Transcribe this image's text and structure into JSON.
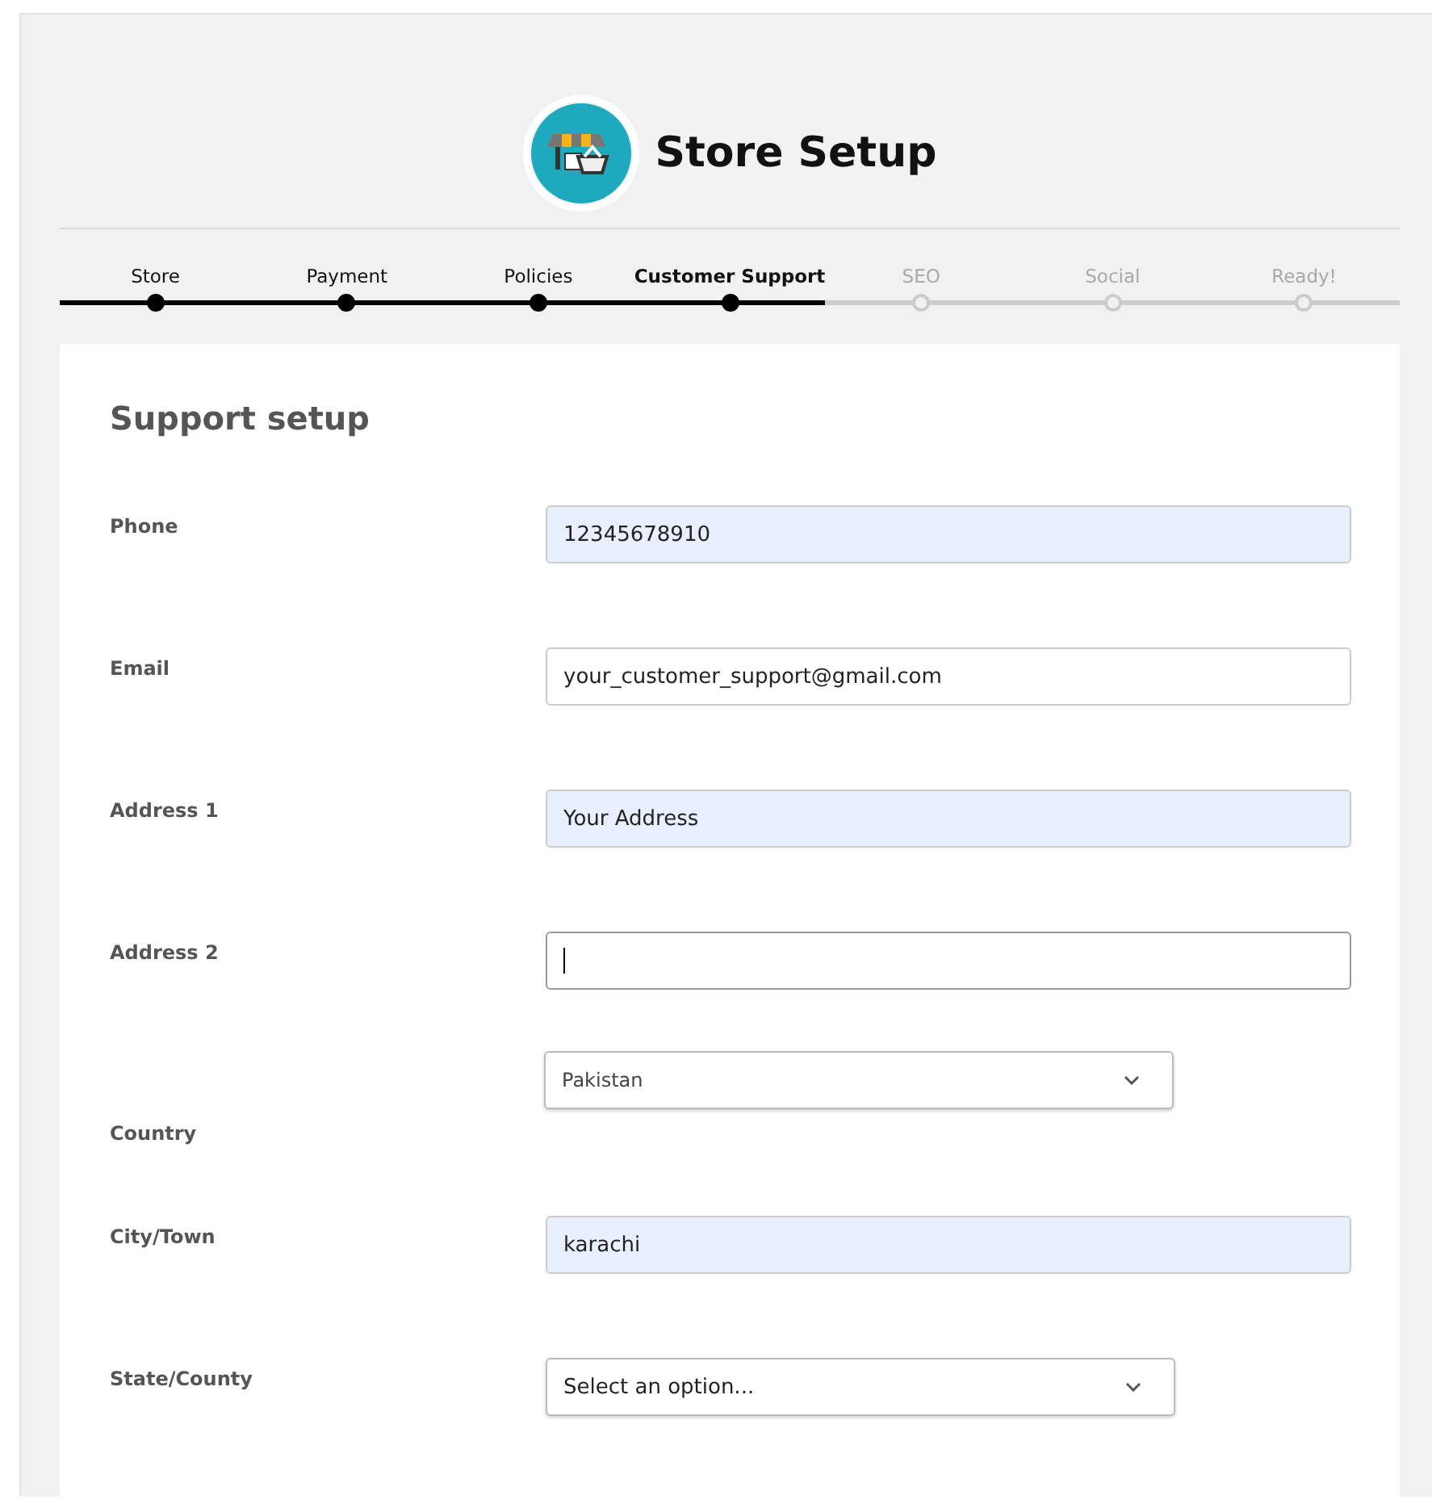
{
  "header": {
    "title": "Store Setup"
  },
  "steps": [
    {
      "label": "Store",
      "completed": true,
      "selected": false
    },
    {
      "label": "Payment",
      "completed": true,
      "selected": false
    },
    {
      "label": "Policies",
      "completed": true,
      "selected": false
    },
    {
      "label": "Customer Support",
      "completed": true,
      "selected": true
    },
    {
      "label": "SEO",
      "completed": false,
      "selected": false
    },
    {
      "label": "Social",
      "completed": false,
      "selected": false
    },
    {
      "label": "Ready!",
      "completed": false,
      "selected": false
    }
  ],
  "form": {
    "title": "Support setup",
    "fields": [
      {
        "label": "Phone",
        "kind": "text",
        "value": "12345678910",
        "autofilled": true,
        "focused": false
      },
      {
        "label": "Email",
        "kind": "text",
        "value": "your_customer_support@gmail.com",
        "autofilled": false,
        "focused": false
      },
      {
        "label": "Address 1",
        "kind": "text",
        "value": "Your Address",
        "autofilled": true,
        "focused": false
      },
      {
        "label": "Address 2",
        "kind": "text",
        "autofilled": false,
        "focused": true
      },
      {
        "label": "Country",
        "kind": "select",
        "value": "Pakistan",
        "autofilled": false,
        "focused": false
      },
      {
        "label": "City/Town",
        "kind": "text",
        "value": "karachi",
        "autofilled": true,
        "focused": false
      },
      {
        "label": "State/County",
        "kind": "select",
        "value": "Select an option...",
        "autofilled": false,
        "focused": false
      }
    ]
  }
}
